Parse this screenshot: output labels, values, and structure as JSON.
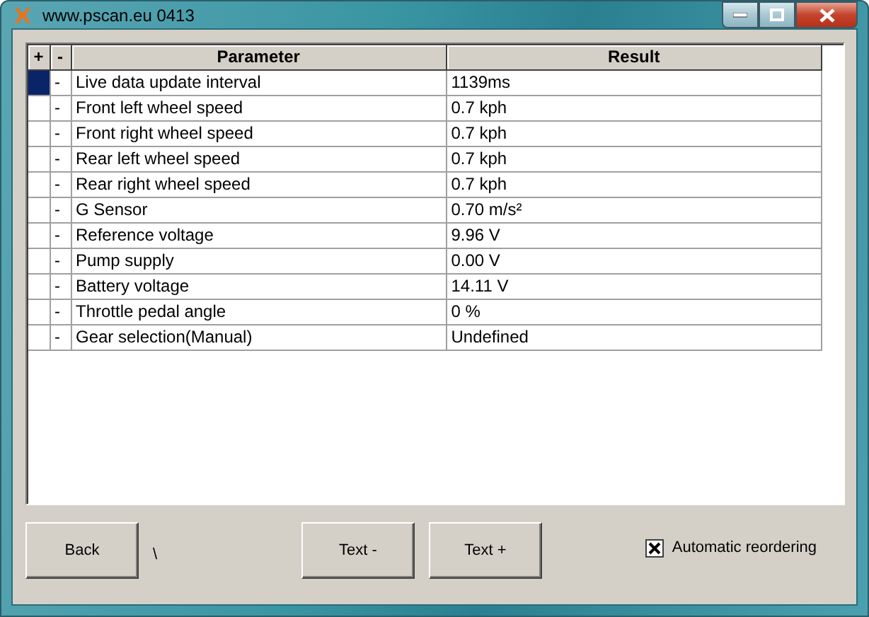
{
  "window": {
    "title": "www.pscan.eu 0413"
  },
  "table": {
    "columns": [
      "+",
      "-",
      "Parameter",
      "Result"
    ],
    "rows": [
      {
        "marker": "-",
        "parameter": "Live data update interval",
        "result": "1139ms",
        "selected": true
      },
      {
        "marker": "-",
        "parameter": "Front left wheel speed",
        "result": "0.7 kph",
        "selected": false
      },
      {
        "marker": "-",
        "parameter": "Front right wheel speed",
        "result": "0.7 kph",
        "selected": false
      },
      {
        "marker": "-",
        "parameter": "Rear left wheel speed",
        "result": "0.7 kph",
        "selected": false
      },
      {
        "marker": "-",
        "parameter": "Rear right wheel speed",
        "result": "0.7 kph",
        "selected": false
      },
      {
        "marker": "-",
        "parameter": "G Sensor",
        "result": "0.70 m/s²",
        "selected": false
      },
      {
        "marker": "-",
        "parameter": "Reference voltage",
        "result": "9.96 V",
        "selected": false
      },
      {
        "marker": "-",
        "parameter": "Pump supply",
        "result": "0.00 V",
        "selected": false
      },
      {
        "marker": "-",
        "parameter": "Battery voltage",
        "result": "14.11 V",
        "selected": false
      },
      {
        "marker": "-",
        "parameter": "Throttle pedal angle",
        "result": "0 %",
        "selected": false
      },
      {
        "marker": "-",
        "parameter": "Gear selection(Manual)",
        "result": "Undefined",
        "selected": false
      }
    ]
  },
  "buttons": {
    "back": "Back",
    "path": "\\",
    "text_minus": "Text -",
    "text_plus": "Text +"
  },
  "auto_reorder": {
    "label": "Automatic reordering",
    "checked": true
  }
}
